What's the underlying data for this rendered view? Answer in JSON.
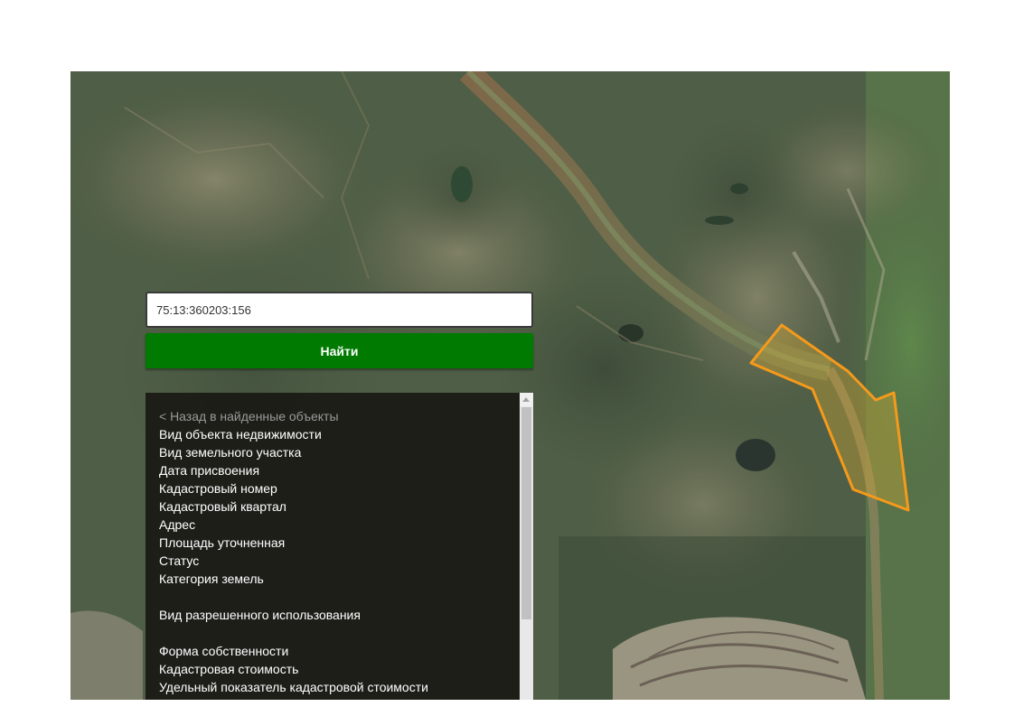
{
  "search": {
    "value": "75:13:360203:156",
    "button_label": "Найти"
  },
  "info_panel": {
    "back_link": "< Назад в найденные объекты",
    "fields": [
      "Вид объекта недвижимости",
      "Вид земельного участка",
      "Дата присвоения",
      "Кадастровый номер",
      "Кадастровый квартал",
      "Адрес",
      "Площадь уточненная",
      "Статус",
      "Категория земель",
      "",
      "Вид разрешенного использования",
      "",
      "Форма собственности",
      "Кадастровая стоимость",
      "Удельный показатель кадастровой стоимости"
    ]
  },
  "map": {
    "view": "satellite",
    "parcel_outline_color": "#f59a1b",
    "parcel_fill_color": "#e0b030"
  }
}
